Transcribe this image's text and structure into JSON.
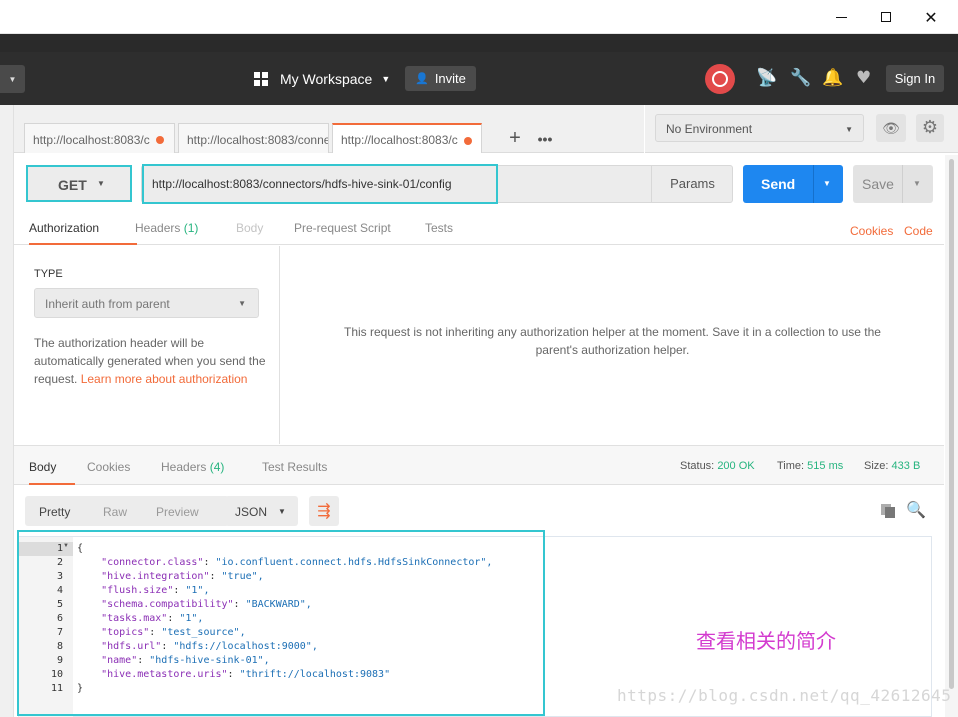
{
  "window": {
    "minimize": "",
    "maximize": "",
    "close": "✕"
  },
  "header": {
    "workspace": "My Workspace",
    "invite": "Invite",
    "sign_in": "Sign In"
  },
  "tabs": [
    {
      "label": "http://localhost:8083/c",
      "unsaved": true
    },
    {
      "label": "http://localhost:8083/conne",
      "unsaved": false
    },
    {
      "label": "http://localhost:8083/c",
      "unsaved": true,
      "active": true
    }
  ],
  "tab_actions": {
    "add": "+",
    "more": "•••"
  },
  "environment": {
    "selected": "No Environment"
  },
  "request": {
    "method": "GET",
    "url": "http://localhost:8083/connectors/hdfs-hive-sink-01/config",
    "params": "Params",
    "send": "Send",
    "save": "Save"
  },
  "request_tabs": {
    "authorization": "Authorization",
    "headers": "Headers",
    "headers_count": "(1)",
    "body": "Body",
    "pre_request": "Pre-request Script",
    "tests": "Tests",
    "cookies": "Cookies",
    "code": "Code"
  },
  "auth": {
    "type_label": "TYPE",
    "type_value": "Inherit auth from parent",
    "desc_1": "The authorization header will be automatically generated when you send the request. ",
    "desc_link": "Learn more about authorization",
    "message_1": "This request is not inheriting any authorization helper at the moment. Save it in a collection to use the",
    "message_2": "parent's authorization helper."
  },
  "response_tabs": {
    "body": "Body",
    "cookies": "Cookies",
    "headers": "Headers",
    "headers_count": "(4)",
    "test_results": "Test Results"
  },
  "status": {
    "status_label": "Status:",
    "status_value": "200 OK",
    "time_label": "Time:",
    "time_value": "515 ms",
    "size_label": "Size:",
    "size_value": "433 B"
  },
  "format": {
    "pretty": "Pretty",
    "raw": "Raw",
    "preview": "Preview",
    "type": "JSON"
  },
  "body_lines": [
    {
      "n": "1",
      "key": "",
      "val": "",
      "raw": "{"
    },
    {
      "n": "2",
      "key": "\"connector.class\"",
      "val": "\"io.confluent.connect.hdfs.HdfsSinkConnector\","
    },
    {
      "n": "3",
      "key": "\"hive.integration\"",
      "val": "\"true\","
    },
    {
      "n": "4",
      "key": "\"flush.size\"",
      "val": "\"1\","
    },
    {
      "n": "5",
      "key": "\"schema.compatibility\"",
      "val": "\"BACKWARD\","
    },
    {
      "n": "6",
      "key": "\"tasks.max\"",
      "val": "\"1\","
    },
    {
      "n": "7",
      "key": "\"topics\"",
      "val": "\"test_source\","
    },
    {
      "n": "8",
      "key": "\"hdfs.url\"",
      "val": "\"hdfs://localhost:9000\","
    },
    {
      "n": "9",
      "key": "\"name\"",
      "val": "\"hdfs-hive-sink-01\","
    },
    {
      "n": "10",
      "key": "\"hive.metastore.uris\"",
      "val": "\"thrift://localhost:9083\""
    },
    {
      "n": "11",
      "key": "",
      "val": "",
      "raw": "}"
    }
  ],
  "annotation": "查看相关的简介",
  "watermark": "https://blog.csdn.net/qq_42612645",
  "colors": {
    "accent": "#f26b3a",
    "send": "#1e87f0",
    "highlight": "#34c6d0",
    "success": "#26b47f"
  }
}
